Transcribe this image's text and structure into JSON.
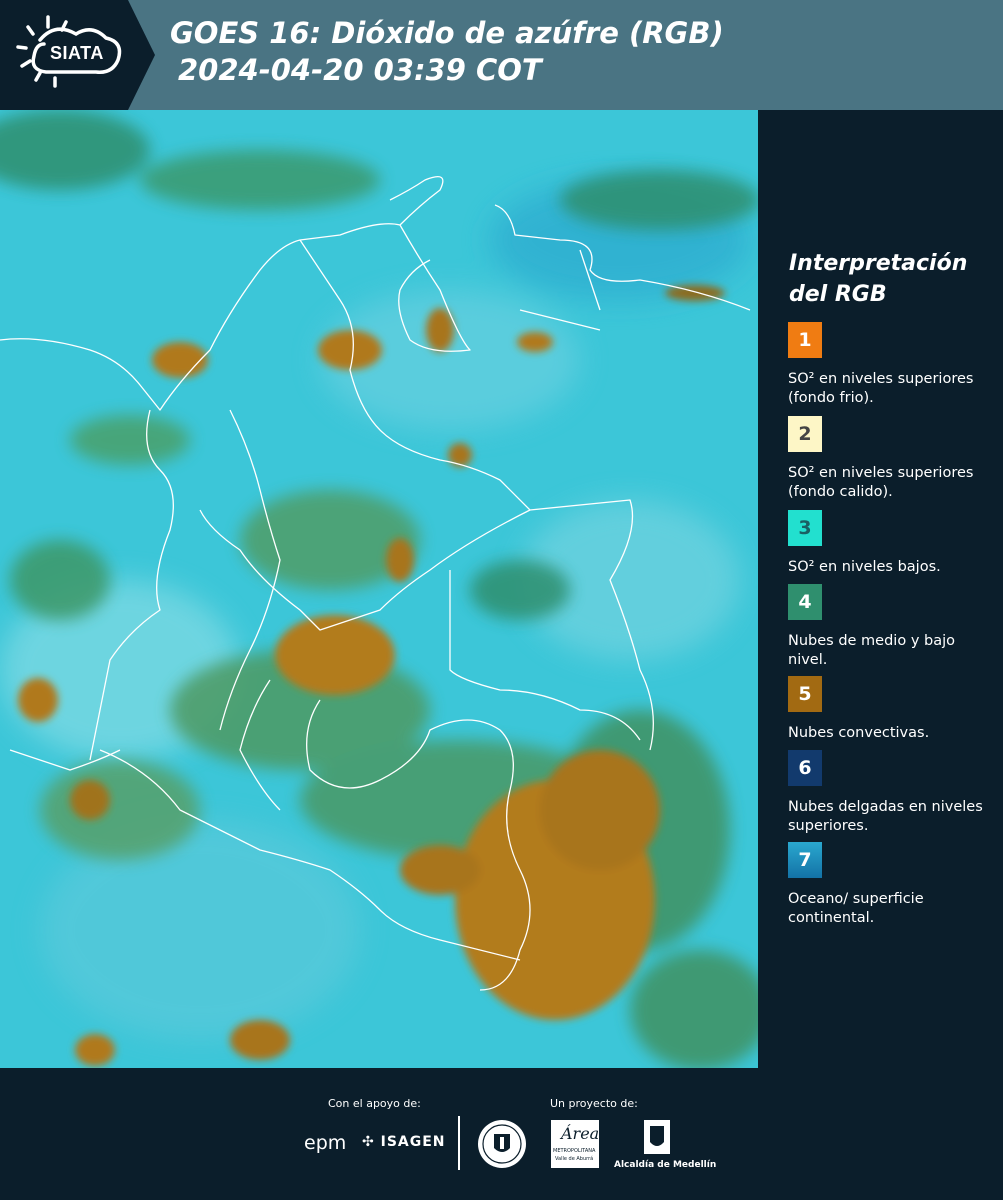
{
  "header": {
    "logo_text": "SIATA",
    "title_line1": "GOES 16: Dióxido de azúfre (RGB)",
    "title_line2": "2024-04-20 03:39 COT"
  },
  "legend": {
    "title": "Interpretación del RGB",
    "items": [
      {
        "number": "1",
        "color": "#f07c12",
        "text_color": "#ffffff",
        "text": "SO² en niveles superiores (fondo frio)."
      },
      {
        "number": "2",
        "color": "#fdf6c6",
        "text_color": "#444444",
        "text": "SO² en niveles superiores (fondo calido)."
      },
      {
        "number": "3",
        "color": "#22e0cf",
        "text_color": "#1a5f63",
        "text": "SO² en niveles bajos."
      },
      {
        "number": "4",
        "color": "#2f8f6e",
        "text_color": "#ffffff",
        "text": "Nubes de medio y bajo nivel."
      },
      {
        "number": "5",
        "color": "#a26a12",
        "text_color": "#ffffff",
        "text": "Nubes convectivas."
      },
      {
        "number": "6",
        "color": "#123a6d",
        "text_color": "#ffffff",
        "text": "Nubes delgadas en niveles superiores."
      },
      {
        "number": "7",
        "color": "#1f8fc0",
        "text_color": "#ffffff",
        "text": "Oceano/ superficie continental."
      }
    ]
  },
  "footer": {
    "support_label": "Con el apoyo de:",
    "project_label": "Un proyecto de:",
    "sponsor_epm": "epm",
    "sponsor_isagen": "ISAGEN",
    "partner_area_title": "Área",
    "partner_area_subtitle": "METROPOLITANA",
    "partner_area_subtitle2": "Valle de Aburrá",
    "partner_alcaldia": "Alcaldía de Medellín"
  }
}
